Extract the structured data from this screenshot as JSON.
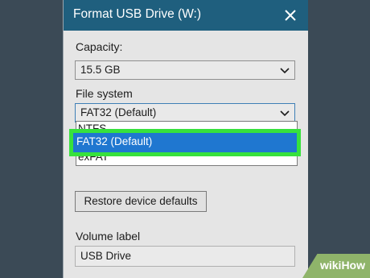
{
  "dialog": {
    "title": "Format USB Drive (W:)",
    "capacity_label": "Capacity:",
    "capacity_value": "15.5 GB",
    "filesystem_label": "File system",
    "filesystem_value": "FAT32 (Default)",
    "filesystem_options": [
      "NTFS",
      "FAT32 (Default)",
      "exFAT"
    ],
    "highlighted_option": "FAT32 (Default)",
    "restore_button": "Restore device defaults",
    "volume_label": "Volume label",
    "volume_value": "USB Drive",
    "highlight_color": "#37e13d",
    "selection_color": "#1f77d0",
    "titlebar_color": "#1f5f7e"
  },
  "watermark": {
    "text": "wikiHow"
  }
}
